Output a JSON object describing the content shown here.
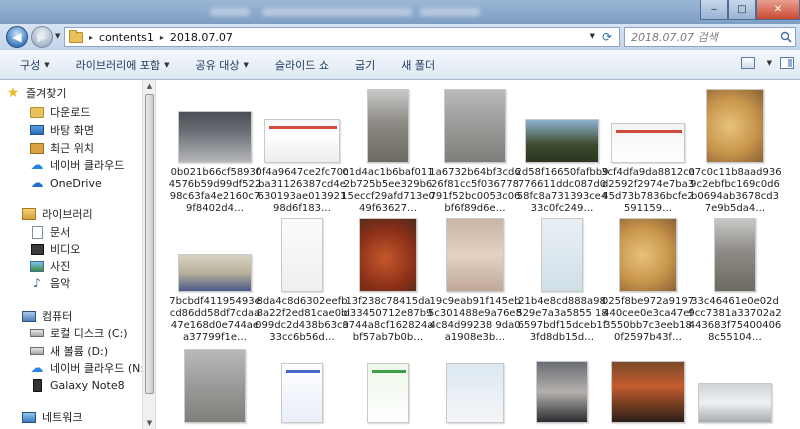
{
  "window": {
    "close_glyph": "✕",
    "minimize_glyph": "‒",
    "maximize_glyph": "□"
  },
  "address": {
    "crumbs": [
      "contents1",
      "2018.07.07"
    ],
    "separator": "▸",
    "search_placeholder": "2018.07.07 검색"
  },
  "toolbar": {
    "items": [
      "구성",
      "라이브러리에 포함",
      "공유 대상",
      "슬라이드 쇼",
      "굽기",
      "새 폴더"
    ]
  },
  "nav": {
    "favorites": "즐겨찾기",
    "downloads": "다운로드",
    "desktop": "바탕 화면",
    "recent": "최근 위치",
    "naver_cloud": "네이버 클라우드",
    "onedrive": "OneDrive",
    "libraries": "라이브러리",
    "documents": "문서",
    "videos": "비디오",
    "pictures": "사진",
    "music": "음악",
    "computer": "컴퓨터",
    "local_disk": "로컬 디스크 (C:)",
    "new_volume": "새 볼륨 (D:)",
    "naver_cloud_drive": "네이버 클라우드 (N:)",
    "galaxy": "Galaxy Note8",
    "network": "네트워크"
  },
  "files": [
    {
      "name": "0b021b66cf5893f4576b59d99df52298c63fa4e2160c79f8402d4…",
      "kind": "room"
    },
    {
      "name": "0f4a9647ce2fc70cba31126387cd4e630193ae01392198d6f183…",
      "kind": "doc"
    },
    {
      "name": "01d4ac1b6baf0112b725b5ee329b615eccf29afd713e049f63627…",
      "kind": "alley"
    },
    {
      "name": "1a6732b64bf3cd626f81cc5f036778791f52bc0053c06bf6f89d6e…",
      "kind": "tripod"
    },
    {
      "name": "2d58f16650fafbb9776611ddc087d058fc8a731393ce433c0fc249…",
      "kind": "trees"
    },
    {
      "name": "3cf4dfa9da8812cad2592f2974e7ba345d73b7836bcfe2591159…",
      "kind": "screen"
    },
    {
      "name": "07c0c11b8aad9369c2ebfbc169c0d6b0694ab3678cd37e9b5da4…",
      "kind": "food"
    },
    {
      "name": "7bcbdf41195493ecd86dd58df7cdaa47e168d0e744aea37799f1e…",
      "kind": "tray"
    },
    {
      "name": "8da4c8d6302eefb8a22f2ed81cae0b099dc2d438b63c933cc6b56d…",
      "kind": "paper"
    },
    {
      "name": "13f238c78415da d33450712e87b9a744a8cf162824abf57ab7b0b…",
      "kind": "meat"
    },
    {
      "name": "19c9eab91f145eb5c301488e9a76e84c84d99238 9da0a1908e3b…",
      "kind": "person"
    },
    {
      "name": "21b4e8cd888a98529e7a3a5855 186597bdf15dceb1f3fd8db15d…",
      "kind": "chat"
    },
    {
      "name": "025f8be972a9197440cee0e3ca47ef3550bb7c3eeb180f2597b43f…",
      "kind": "food"
    },
    {
      "name": "33c46461e0e02d9cc7381a33702a2443683f754004068c55104…",
      "kind": "alley"
    },
    {
      "name": "",
      "kind": "tripod"
    },
    {
      "name": "",
      "kind": "doc2"
    },
    {
      "name": "",
      "kind": "chat2"
    },
    {
      "name": "",
      "kind": "chat3"
    },
    {
      "name": "",
      "kind": "person2"
    },
    {
      "name": "",
      "kind": "restaurant"
    },
    {
      "name": "",
      "kind": "cups"
    }
  ]
}
